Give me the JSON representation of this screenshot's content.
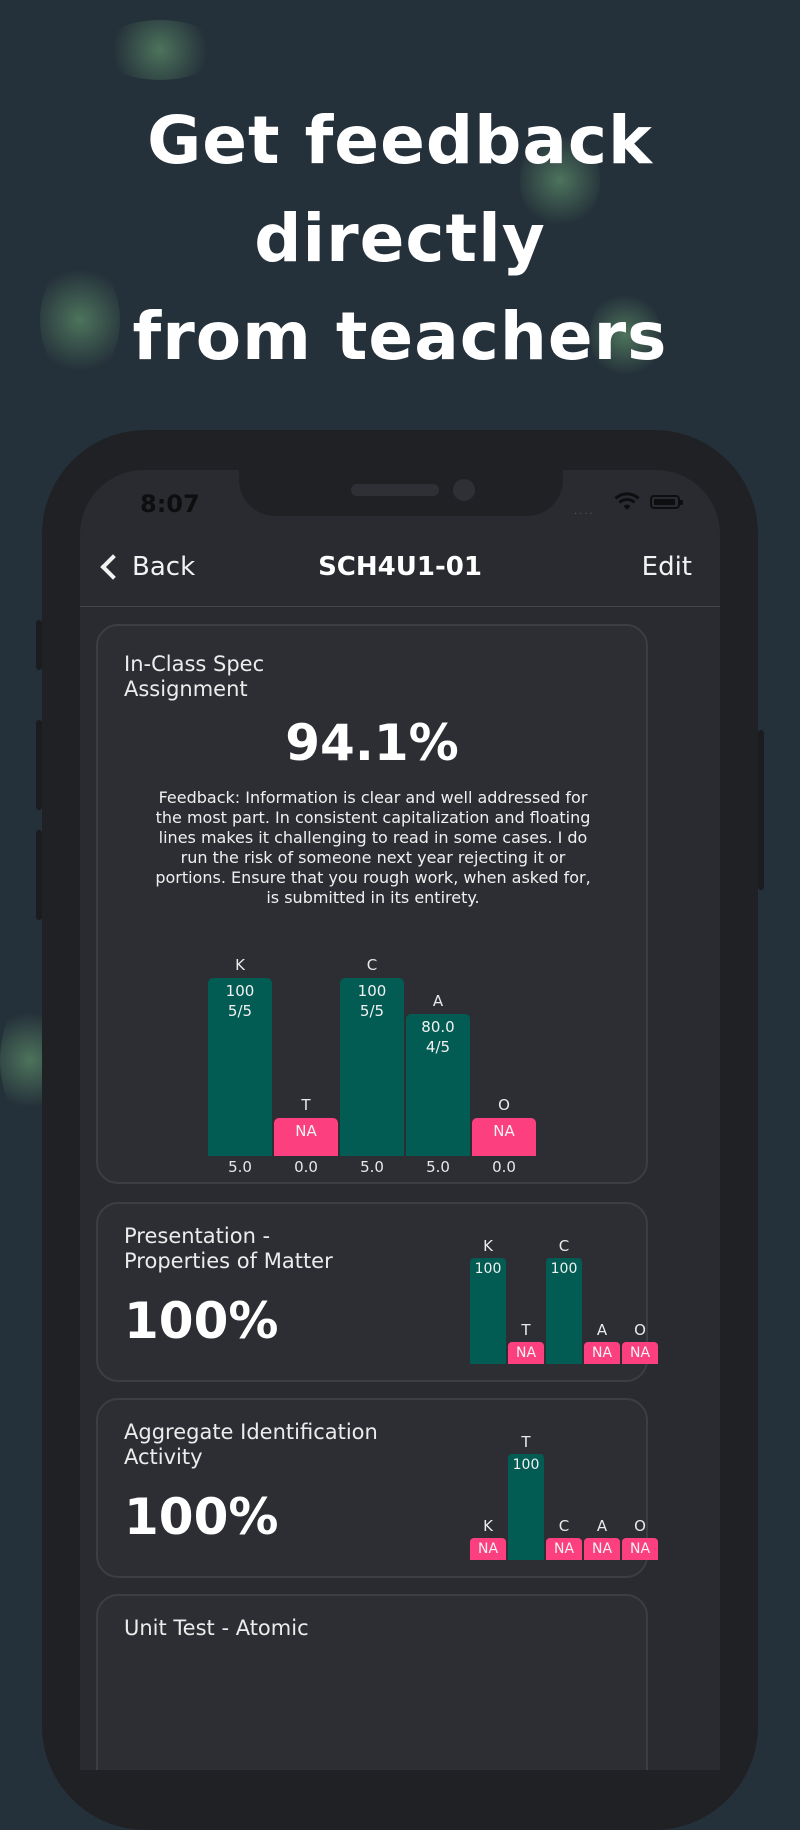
{
  "headline": {
    "line1": "Get feedback directly",
    "line2": "from teachers"
  },
  "status_bar": {
    "time": "8:07",
    "signal_dots": "....",
    "wifi_icon": "wifi-icon",
    "battery_icon": "battery-icon"
  },
  "nav": {
    "back_label": "Back",
    "title": "SCH4U1-01",
    "edit_label": "Edit"
  },
  "colors": {
    "green_bar": "#035c53",
    "pink_bar": "#fb3f7f",
    "background": "#25313a",
    "card": "#2d2e34"
  },
  "assignments": [
    {
      "title_line1": "In-Class Spec",
      "title_line2": "Assignment",
      "grade": "94.1%",
      "feedback": "Feedback: Information is clear and well addressed for the most part. In consistent capitalization and floating lines makes it challenging to read in some cases. I do run the risk of someone next year rejecting it or portions. Ensure that you rough work, when asked for, is submitted in its entirety.",
      "chart_data": {
        "type": "bar",
        "categories": [
          "K",
          "T",
          "C",
          "A",
          "O"
        ],
        "series": [
          {
            "values": [
              100,
              0,
              100,
              80.0,
              0
            ]
          }
        ],
        "value_labels": [
          "100",
          "NA",
          "100",
          "80.0",
          "NA"
        ],
        "score_labels": [
          "5/5",
          "",
          "5/5",
          "4/5",
          ""
        ],
        "weights": [
          "5.0",
          "0.0",
          "5.0",
          "5.0",
          "0.0"
        ],
        "status": [
          "graded",
          "na",
          "graded",
          "graded",
          "na"
        ],
        "ylim": [
          0,
          100
        ]
      }
    },
    {
      "title_line1": "Presentation -",
      "title_line2": "Properties of Matter",
      "grade": "100%",
      "chart_data": {
        "type": "bar",
        "categories": [
          "K",
          "T",
          "C",
          "A",
          "O"
        ],
        "series": [
          {
            "values": [
              100,
              0,
              100,
              0,
              0
            ]
          }
        ],
        "value_labels": [
          "100",
          "NA",
          "100",
          "NA",
          "NA"
        ],
        "status": [
          "graded",
          "na",
          "graded",
          "na",
          "na"
        ],
        "ylim": [
          0,
          100
        ]
      }
    },
    {
      "title_line1": "Aggregate Identification",
      "title_line2": "Activity",
      "grade": "100%",
      "chart_data": {
        "type": "bar",
        "categories": [
          "K",
          "T",
          "C",
          "A",
          "O"
        ],
        "series": [
          {
            "values": [
              0,
              100,
              0,
              0,
              0
            ]
          }
        ],
        "value_labels": [
          "NA",
          "100",
          "NA",
          "NA",
          "NA"
        ],
        "status": [
          "na",
          "graded",
          "na",
          "na",
          "na"
        ],
        "ylim": [
          0,
          100
        ]
      }
    },
    {
      "title_line1": "Unit Test - Atomic"
    }
  ]
}
